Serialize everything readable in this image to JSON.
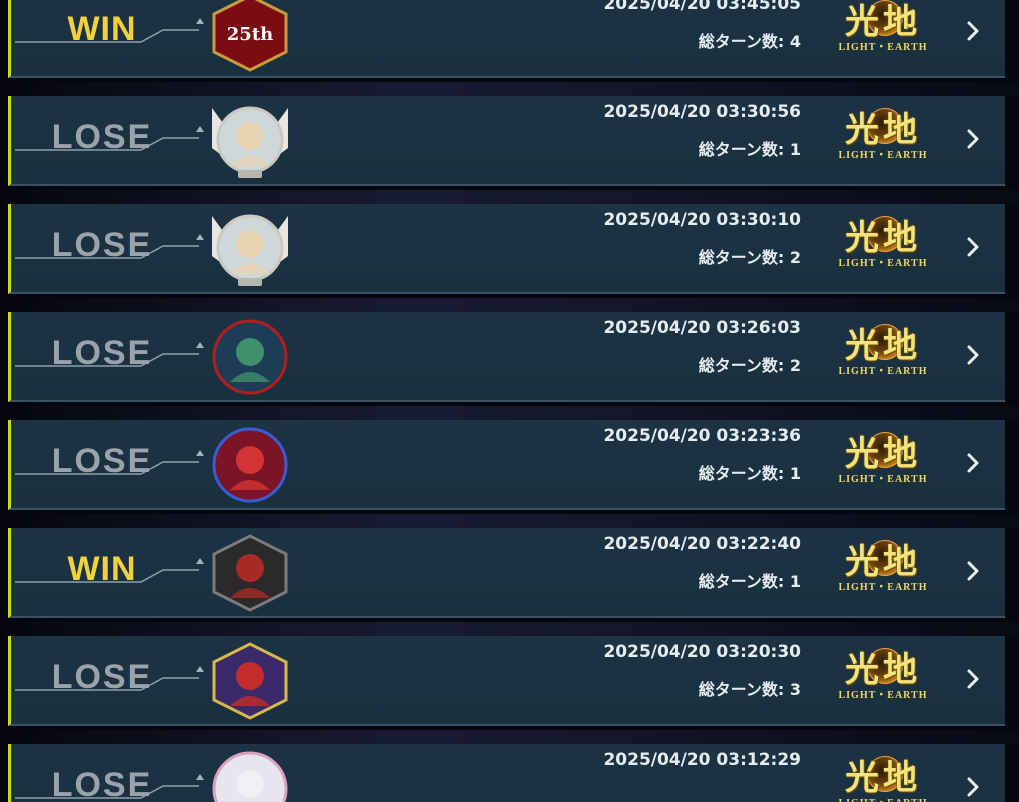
{
  "matches": [
    {
      "result": "WIN",
      "datetime": "2025/04/20 03:45:05",
      "turns_label": "総ターン数: 4",
      "opponent_icon": "yugioh-25th-anniversary-icon",
      "attribute_kanji": "光地",
      "attribute_en": "LIGHT・EARTH"
    },
    {
      "result": "LOSE",
      "datetime": "2025/04/20 03:30:56",
      "turns_label": "総ターン数: 1",
      "opponent_icon": "blonde-girl-winged-avatar-icon",
      "attribute_kanji": "光地",
      "attribute_en": "LIGHT・EARTH"
    },
    {
      "result": "LOSE",
      "datetime": "2025/04/20 03:30:10",
      "turns_label": "総ターン数: 2",
      "opponent_icon": "blonde-girl-winged-avatar-icon",
      "attribute_kanji": "光地",
      "attribute_en": "LIGHT・EARTH"
    },
    {
      "result": "LOSE",
      "datetime": "2025/04/20 03:26:03",
      "turns_label": "総ターン数: 2",
      "opponent_icon": "green-haired-boy-avatar-icon",
      "attribute_kanji": "光地",
      "attribute_en": "LIGHT・EARTH"
    },
    {
      "result": "LOSE",
      "datetime": "2025/04/20 03:23:36",
      "turns_label": "総ターン数: 1",
      "opponent_icon": "red-haired-girl-avatar-icon",
      "attribute_kanji": "光地",
      "attribute_en": "LIGHT・EARTH"
    },
    {
      "result": "WIN",
      "datetime": "2025/04/20 03:22:40",
      "turns_label": "総ターン数: 1",
      "opponent_icon": "red-cap-goggles-avatar-icon",
      "attribute_kanji": "光地",
      "attribute_en": "LIGHT・EARTH"
    },
    {
      "result": "LOSE",
      "datetime": "2025/04/20 03:20:30",
      "turns_label": "総ターン数: 3",
      "opponent_icon": "red-hood-girl-avatar-icon",
      "attribute_kanji": "光地",
      "attribute_en": "LIGHT・EARTH"
    },
    {
      "result": "LOSE",
      "datetime": "2025/04/20 03:12:29",
      "turns_label": "",
      "opponent_icon": "white-flower-girl-avatar-icon",
      "attribute_kanji": "光地",
      "attribute_en": "LIGHT・EARTH"
    }
  ],
  "colors": {
    "win": "#f2d23a",
    "lose": "#9aa3aa",
    "accent": "#c8dc1e",
    "panel": "#1c3344"
  }
}
